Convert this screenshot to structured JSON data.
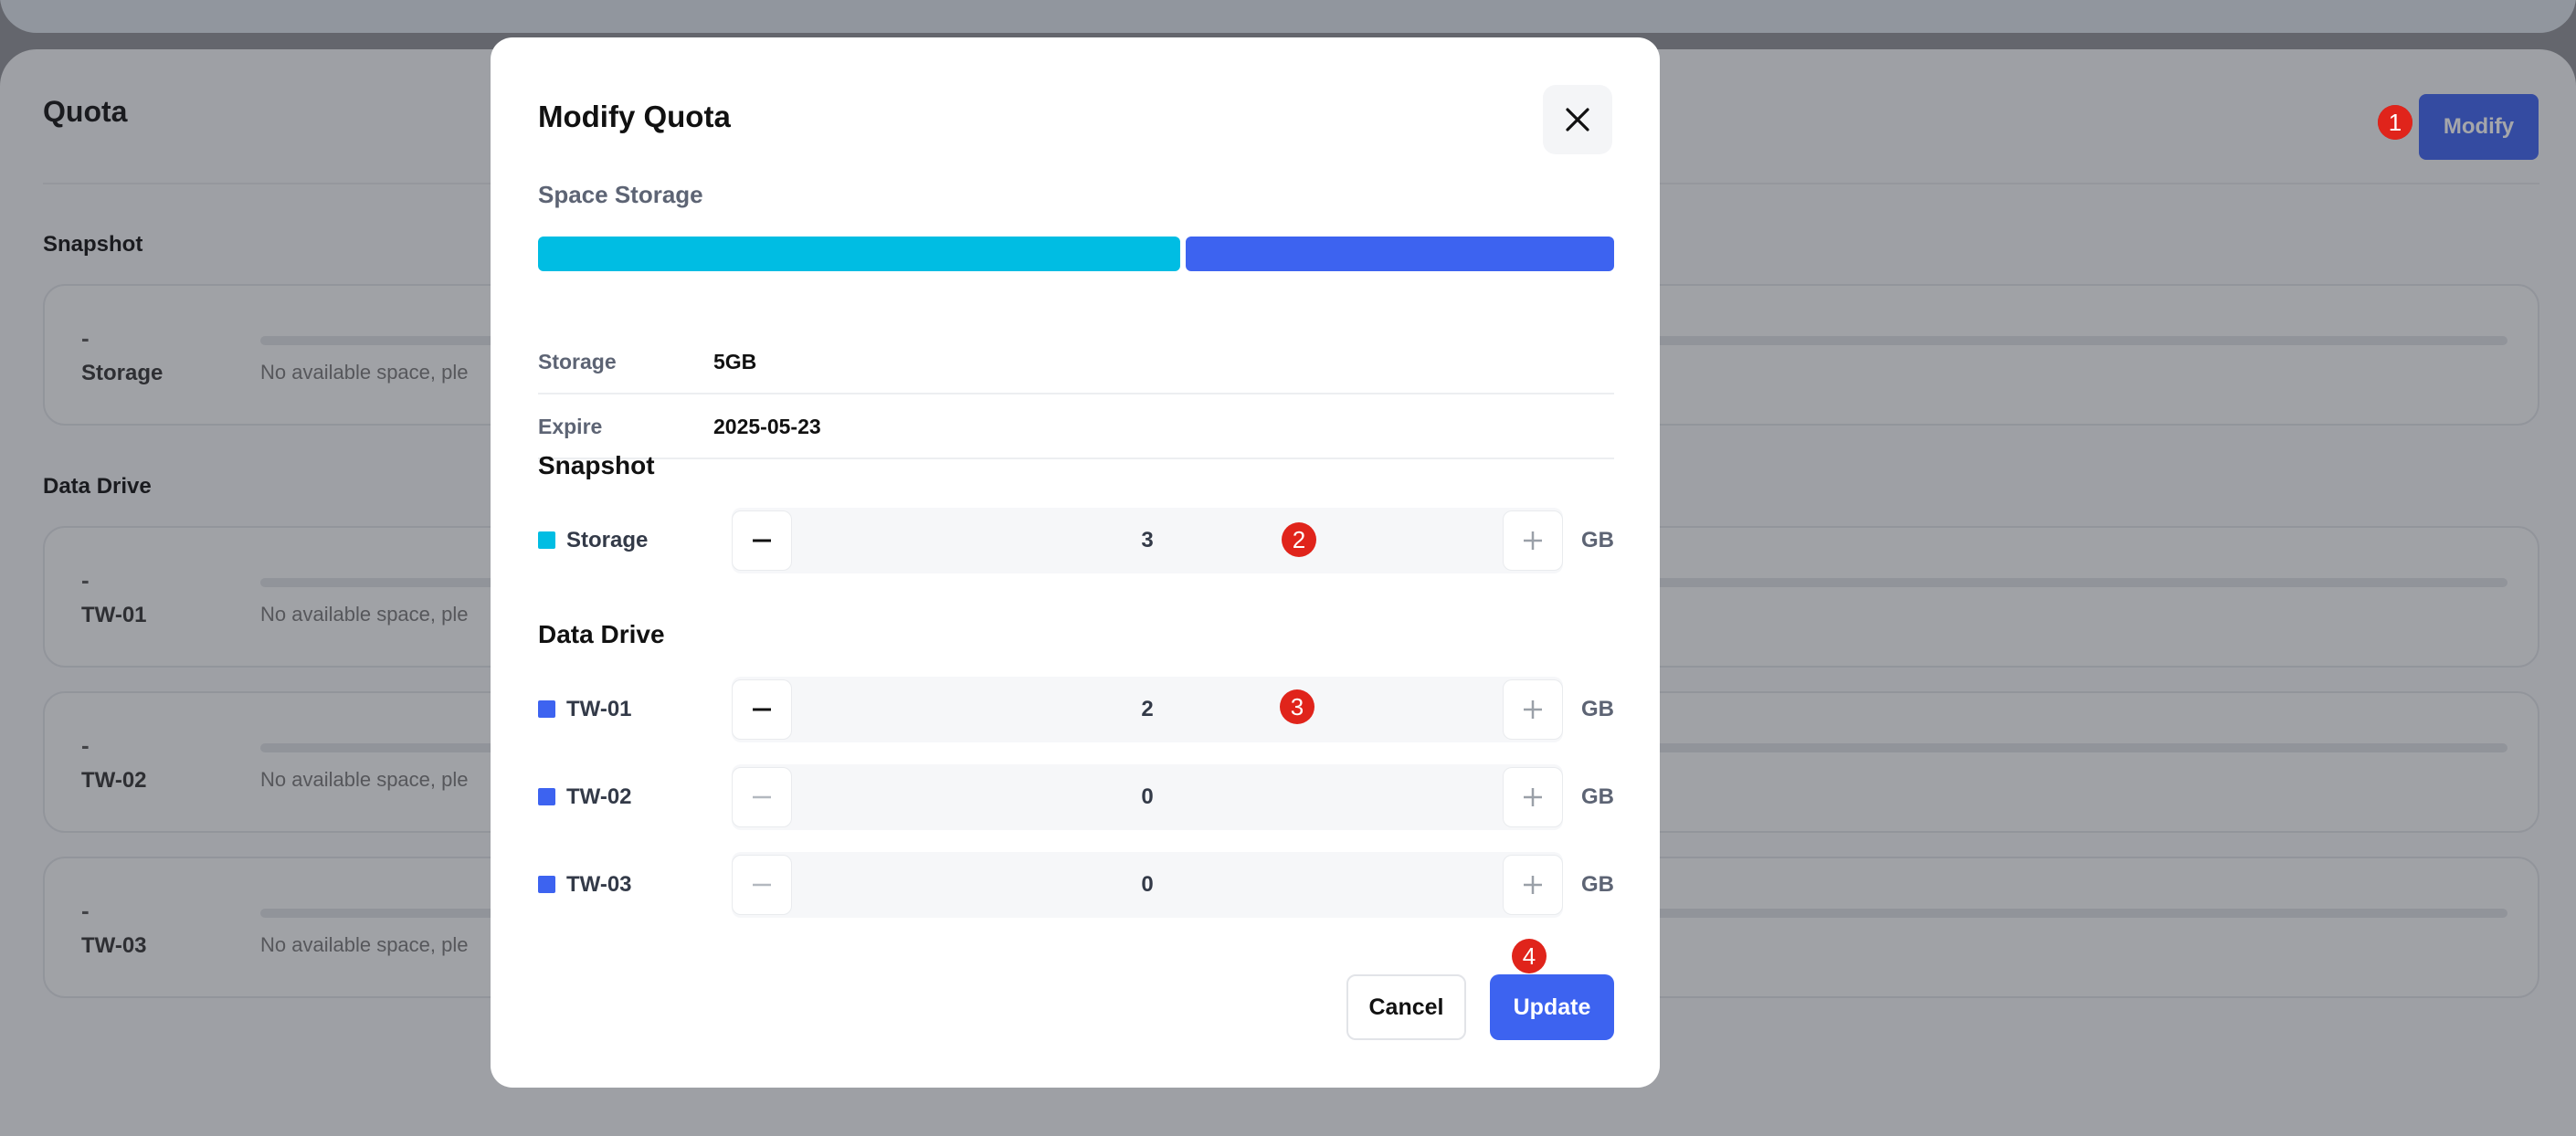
{
  "background": {
    "page_title": "Quota",
    "modify_button": "Modify",
    "sections": [
      {
        "title": "Snapshot",
        "items": [
          {
            "value": "-",
            "name": "Storage",
            "message": "No available space, ple"
          }
        ]
      },
      {
        "title": "Data Drive",
        "items": [
          {
            "value": "-",
            "name": "TW-01",
            "message": "No available space, ple"
          },
          {
            "value": "-",
            "name": "TW-02",
            "message": "No available space, ple"
          },
          {
            "value": "-",
            "name": "TW-03",
            "message": "No available space, ple"
          }
        ]
      }
    ]
  },
  "markers": [
    "1",
    "2",
    "3",
    "4"
  ],
  "modal": {
    "title": "Modify Quota",
    "close_icon": "close-icon",
    "space_storage": {
      "label": "Space Storage",
      "segments": [
        {
          "name": "Snapshot Storage",
          "fraction": 0.6,
          "color": "#00bde3"
        },
        {
          "name": "Data Drive",
          "fraction": 0.4,
          "color": "#3d63f0"
        }
      ]
    },
    "info": [
      {
        "key": "Storage",
        "value": "5GB"
      },
      {
        "key": "Expire",
        "value": "2025-05-23"
      }
    ],
    "snapshot": {
      "title": "Snapshot",
      "rows": [
        {
          "label": "Storage",
          "value": "3",
          "unit": "GB",
          "color": "#00bde3",
          "minus_enabled": true
        }
      ]
    },
    "data_drive": {
      "title": "Data Drive",
      "rows": [
        {
          "label": "TW-01",
          "value": "2",
          "unit": "GB",
          "color": "#3d63f0",
          "minus_enabled": true
        },
        {
          "label": "TW-02",
          "value": "0",
          "unit": "GB",
          "color": "#3d63f0",
          "minus_enabled": false
        },
        {
          "label": "TW-03",
          "value": "0",
          "unit": "GB",
          "color": "#3d63f0",
          "minus_enabled": false
        }
      ]
    },
    "cancel_button": "Cancel",
    "update_button": "Update"
  }
}
